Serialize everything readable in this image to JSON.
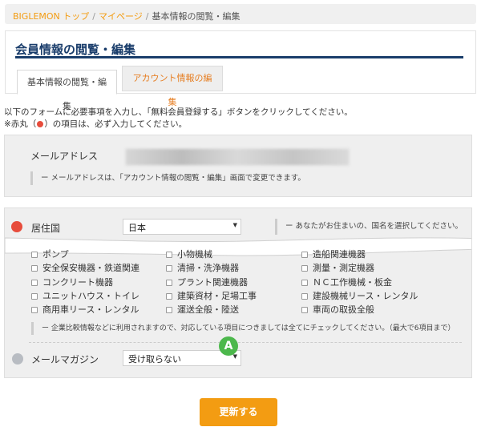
{
  "breadcrumb": {
    "items": [
      "BIGLEMON トップ",
      "マイページ"
    ],
    "separator": "/",
    "current": "基本情報の閲覧・編集"
  },
  "page": {
    "title": "会員情報の閲覧・編集",
    "tabs": [
      {
        "label": "基本情報の閲覧・編集",
        "active": true
      },
      {
        "label": "アカウント情報の編集",
        "active": false
      }
    ]
  },
  "intro": {
    "line1": "以下のフォームに必要事項を入力し、「無料会員登録する」ボタンをクリックしてください。",
    "line2_prefix": "※赤丸（",
    "line2_suffix": "）の項目は、必ず入力してください。"
  },
  "email": {
    "label": "メールアドレス",
    "note": "ー メールアドレスは、「アカウント情報の閲覧・編集」画面で変更できます。"
  },
  "country": {
    "label": "居住国",
    "value": "日本",
    "note": "ー あなたがお住まいの、国名を選択してください。"
  },
  "categories": {
    "partial_row": [
      "ポンプ",
      "小物機械",
      "造船関連機器"
    ],
    "rows": [
      [
        "安全保安機器・鉄道関連",
        "清掃・洗浄機器",
        "測量・測定機器"
      ],
      [
        "コンクリート機器",
        "プラント関連機器",
        "ＮＣ工作機械・板金"
      ],
      [
        "ユニットハウス・トイレ",
        "建築資材・足場工事",
        "建設機械リース・レンタル"
      ],
      [
        "商用車リース・レンタル",
        "運送全般・陸送",
        "車両の取扱全般"
      ]
    ],
    "note": "ー 企業比較情報などに利用されますので、対応している項目につきましては全てにチェックしてください。（最大で6項目まで）"
  },
  "newsletter": {
    "label": "メールマガジン",
    "value": "受け取らない"
  },
  "marker_label": "A",
  "submit_label": "更新する",
  "colors": {
    "accent": "#f39c12",
    "title": "#1a3d6b",
    "required": "#e74c3c",
    "marker": "#4cb84c"
  }
}
